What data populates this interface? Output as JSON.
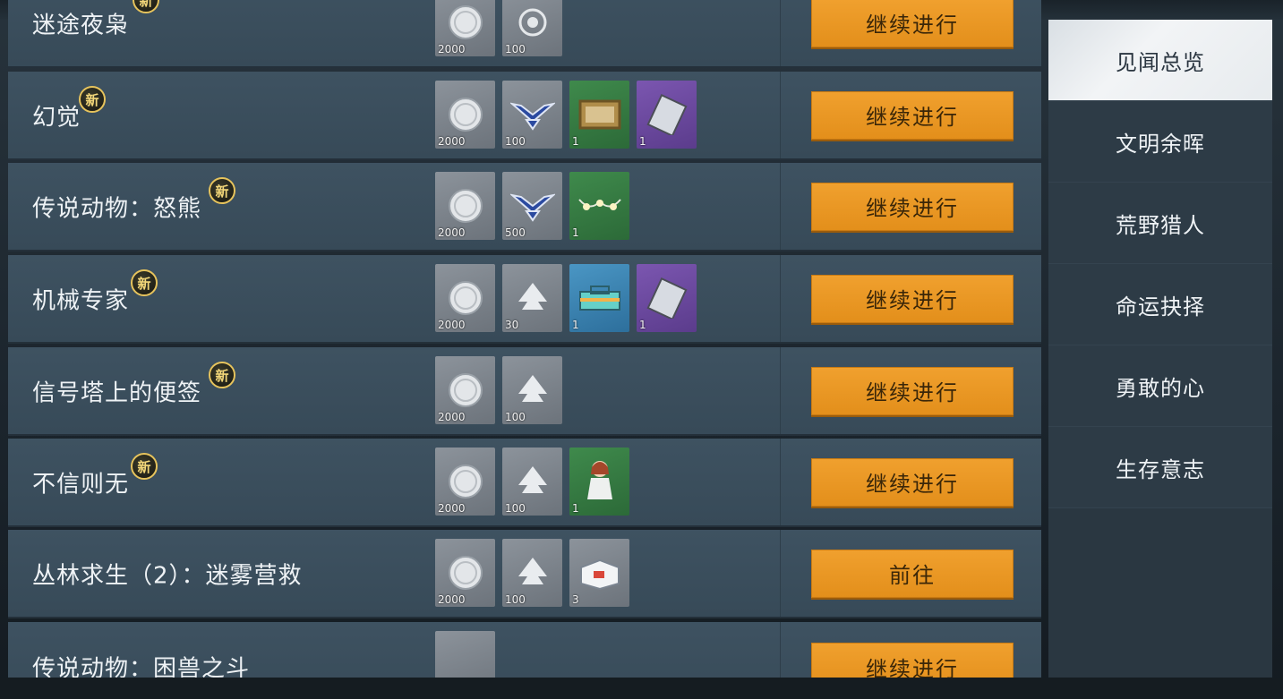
{
  "sidebar": {
    "tabs": [
      {
        "label": "见闻总览",
        "active": true
      },
      {
        "label": "文明余晖",
        "active": false
      },
      {
        "label": "荒野猎人",
        "active": false
      },
      {
        "label": "命运抉择",
        "active": false
      },
      {
        "label": "勇敢的心",
        "active": false
      },
      {
        "label": "生存意志",
        "active": false
      }
    ]
  },
  "badge_label": "新",
  "rows": [
    {
      "title": "迷途夜枭",
      "new": true,
      "button": "继续进行",
      "rewards": [
        {
          "icon": "silver-coin-icon",
          "count": "2000"
        },
        {
          "icon": "badge-emblem-icon",
          "count": "100"
        }
      ]
    },
    {
      "title": "幻觉",
      "new": true,
      "button": "继续进行",
      "rewards": [
        {
          "icon": "silver-coin-icon",
          "count": "2000"
        },
        {
          "icon": "wing-emblem-icon",
          "count": "100"
        },
        {
          "icon": "painting-icon",
          "count": "1"
        },
        {
          "icon": "blueprint-card-icon",
          "count": "1"
        }
      ]
    },
    {
      "title": "传说动物：怒熊",
      "new": true,
      "button": "继续进行",
      "rewards": [
        {
          "icon": "silver-coin-icon",
          "count": "2000"
        },
        {
          "icon": "wing-emblem-icon",
          "count": "500"
        },
        {
          "icon": "string-lights-icon",
          "count": "1"
        }
      ]
    },
    {
      "title": "机械专家",
      "new": true,
      "button": "继续进行",
      "rewards": [
        {
          "icon": "silver-coin-icon",
          "count": "2000"
        },
        {
          "icon": "tree-icon",
          "count": "30"
        },
        {
          "icon": "toolbox-icon",
          "count": "1"
        },
        {
          "icon": "blueprint-card-icon",
          "count": "1"
        }
      ]
    },
    {
      "title": "信号塔上的便签",
      "new": true,
      "button": "继续进行",
      "rewards": [
        {
          "icon": "silver-coin-icon",
          "count": "2000"
        },
        {
          "icon": "tree-icon",
          "count": "100"
        }
      ]
    },
    {
      "title": "不信则无",
      "new": true,
      "button": "继续进行",
      "rewards": [
        {
          "icon": "silver-coin-icon",
          "count": "2000"
        },
        {
          "icon": "tree-icon",
          "count": "100"
        },
        {
          "icon": "doll-icon",
          "count": "1"
        }
      ]
    },
    {
      "title": "丛林求生（2）：迷雾营救",
      "new": false,
      "button": "前往",
      "rewards": [
        {
          "icon": "silver-coin-icon",
          "count": "2000"
        },
        {
          "icon": "tree-icon",
          "count": "100"
        },
        {
          "icon": "supply-box-icon",
          "count": "3"
        }
      ]
    },
    {
      "title": "传说动物：困兽之斗",
      "new": false,
      "button": "继续进行",
      "rewards": [
        {
          "icon": "silver-coin-icon",
          "count": ""
        }
      ]
    }
  ]
}
